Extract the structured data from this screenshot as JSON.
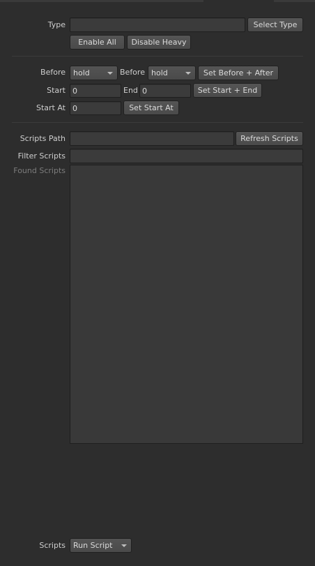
{
  "type_row": {
    "label": "Type",
    "value": "",
    "select_button": "Select Type",
    "enable_all_button": "Enable All",
    "disable_heavy_button": "Disable Heavy"
  },
  "range": {
    "before_label": "Before",
    "before_value": "hold",
    "after_label": "Before",
    "after_value": "hold",
    "set_before_after_button": "Set Before + After",
    "start_label": "Start",
    "start_value": "0",
    "end_label": "End",
    "end_value": "0",
    "set_start_end_button": "Set Start + End",
    "start_at_label": "Start At",
    "start_at_value": "0",
    "set_start_at_button": "Set Start At"
  },
  "scripts": {
    "path_label": "Scripts Path",
    "path_value": "",
    "refresh_button": "Refresh Scripts",
    "filter_label": "Filter Scripts",
    "filter_value": "",
    "found_label": "Found Scripts",
    "found_items": [],
    "run_label": "Scripts",
    "run_value": "Run Script"
  }
}
